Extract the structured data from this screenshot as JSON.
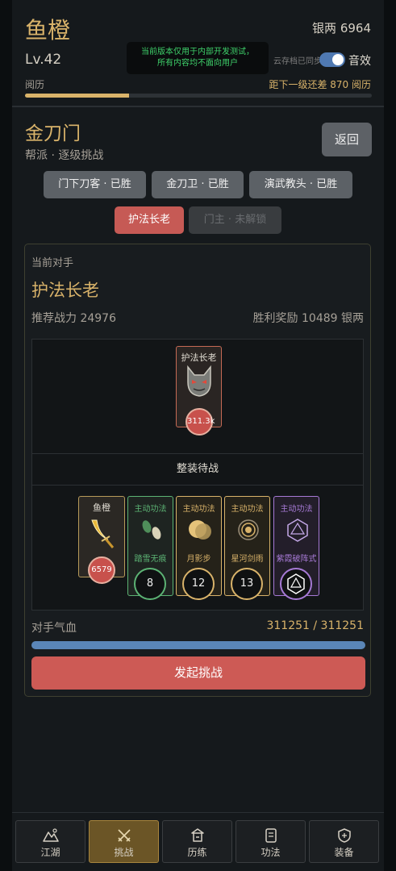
{
  "player": {
    "name": "鱼橙",
    "silver_label": "银两 6964",
    "level": "Lv.42"
  },
  "notice": {
    "line1": "当前版本仅用于内部开发测试，",
    "line2": "所有内容均不面向用户"
  },
  "status": {
    "cloud_sync": "云存档已同步",
    "sound_label": "音效",
    "sound_on": true
  },
  "xp": {
    "label": "阅历",
    "remain": "距下一级还差 870 阅历",
    "progress": 0.3
  },
  "sect": {
    "title": "金刀门",
    "subtitle": "帮派 · 逐级挑战",
    "back_label": "返回"
  },
  "stages": [
    {
      "label": "门下刀客 · 已胜",
      "state": "done"
    },
    {
      "label": "金刀卫 · 已胜",
      "state": "done"
    },
    {
      "label": "演武教头 · 已胜",
      "state": "done"
    },
    {
      "label": "护法长老",
      "state": "current"
    },
    {
      "label": "门主 · 未解锁",
      "state": "locked"
    }
  ],
  "battle": {
    "current_label": "当前对手",
    "opponent_name": "护法长老",
    "power": "推荐战力 24976",
    "reward": "胜利奖励 10489 银两",
    "enemy": {
      "name": "护法长老",
      "hp": "311.3k",
      "icon": "demon-mask-icon"
    },
    "ready_label": "整装待战",
    "hero": {
      "name": "鱼橙",
      "hp": "6579",
      "icon": "golden-blade-icon"
    },
    "skills": [
      {
        "type": "主动功法",
        "name": "踏雪无痕",
        "cd": "8",
        "color": "#5cb374",
        "icon": "footprints-icon"
      },
      {
        "type": "主动功法",
        "name": "月影步",
        "cd": "12",
        "color": "#d9b36a",
        "icon": "moon-icon"
      },
      {
        "type": "主动功法",
        "name": "星河剑雨",
        "cd": "13",
        "color": "#d9b36a",
        "icon": "vortex-icon"
      },
      {
        "type": "主动功法",
        "name": "紫霞破阵式",
        "cd": "",
        "color": "#a77ad6",
        "icon": "hexagon-icon"
      }
    ],
    "opp_hp_label": "对手气血",
    "opp_hp_value": "311251 / 311251",
    "opp_hp_ratio": 1.0,
    "challenge_label": "发起挑战"
  },
  "nav": [
    {
      "label": "江湖",
      "icon": "mountain-icon",
      "active": false
    },
    {
      "label": "挑战",
      "icon": "crossed-swords-icon",
      "active": true
    },
    {
      "label": "历练",
      "icon": "temple-icon",
      "active": false
    },
    {
      "label": "功法",
      "icon": "scroll-icon",
      "active": false
    },
    {
      "label": "装备",
      "icon": "shield-icon",
      "active": false
    }
  ],
  "colors": {
    "gold": "#d9b36a",
    "accent_red": "#cd5a55",
    "blue": "#5a86b8"
  }
}
